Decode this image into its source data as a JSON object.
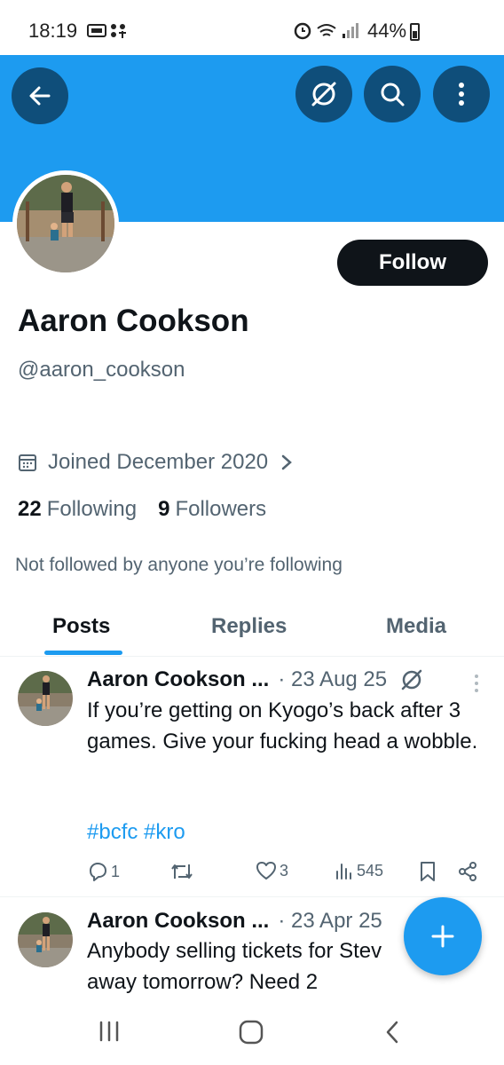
{
  "status_bar": {
    "time": "18:19",
    "battery": "44%"
  },
  "profile": {
    "follow_label": "Follow",
    "display_name": "Aaron Cookson",
    "handle": "@aaron_cookson",
    "joined": "Joined December 2020",
    "following_count": "22",
    "following_label": "Following",
    "followers_count": "9",
    "followers_label": "Followers",
    "not_followed": "Not followed by anyone you’re following"
  },
  "tabs": [
    {
      "label": "Posts",
      "active": true
    },
    {
      "label": "Replies",
      "active": false
    },
    {
      "label": "Media",
      "active": false
    }
  ],
  "posts": [
    {
      "author": "Aaron Cookson ...",
      "meta": "· 23 Aug 25",
      "text": "If you’re getting on Kyogo’s back after 3 games. Give your fucking head a wobble.",
      "hashtags": "#bcfc #kro",
      "replies": "1",
      "retweets": "",
      "likes": "3",
      "views": "545"
    },
    {
      "author": "Aaron Cookson ...",
      "meta": "· 23 Apr 25",
      "text": "Anybody selling tickets for Stev",
      "text2": "away tomorrow? Need 2"
    }
  ],
  "colors": {
    "banner": "#1d9bf0",
    "accent": "#1d9bf0",
    "text": "#0f1419",
    "muted": "#536471"
  },
  "icons": [
    "back-arrow-icon",
    "grok-icon",
    "search-icon",
    "more-vertical-icon",
    "calendar-icon",
    "chevron-right-icon",
    "reply-icon",
    "retweet-icon",
    "like-icon",
    "views-icon",
    "bookmark-icon",
    "share-icon",
    "compose-plus-icon"
  ]
}
